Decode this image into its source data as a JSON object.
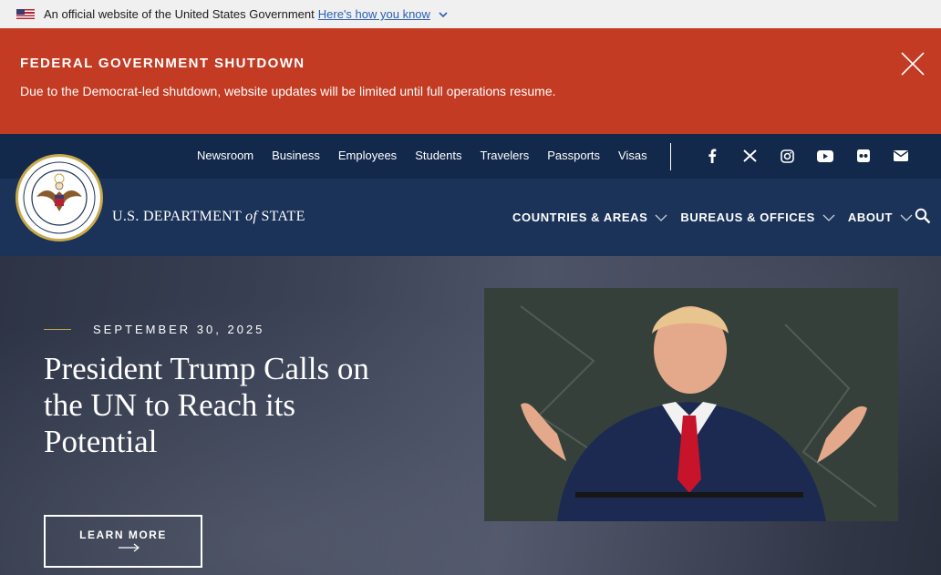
{
  "gov_banner": {
    "text": "An official website of the United States Government",
    "link": "Here's how you know"
  },
  "alert": {
    "title": "FEDERAL GOVERNMENT SHUTDOWN",
    "body": "Due to the Democrat-led shutdown, website updates will be limited until full operations resume."
  },
  "utility_nav": [
    "Newsroom",
    "Business",
    "Employees",
    "Students",
    "Travelers",
    "Passports",
    "Visas"
  ],
  "socials": [
    "facebook-icon",
    "x-icon",
    "instagram-icon",
    "youtube-icon",
    "flickr-icon",
    "email-icon"
  ],
  "brand": {
    "part1": "U.S. DEPARTMENT ",
    "of": "of",
    "part2": " STATE"
  },
  "main_nav": [
    "COUNTRIES & AREAS",
    "BUREAUS & OFFICES",
    "ABOUT"
  ],
  "hero": {
    "date": "SEPTEMBER 30, 2025",
    "headline": "President Trump Calls on the UN to Reach its Potential",
    "cta": "LEARN MORE"
  },
  "colors": {
    "alert_bg": "#c23b22",
    "header_bg": "#1b3358",
    "utility_bg": "#13294b",
    "gold": "#c9a84a"
  }
}
